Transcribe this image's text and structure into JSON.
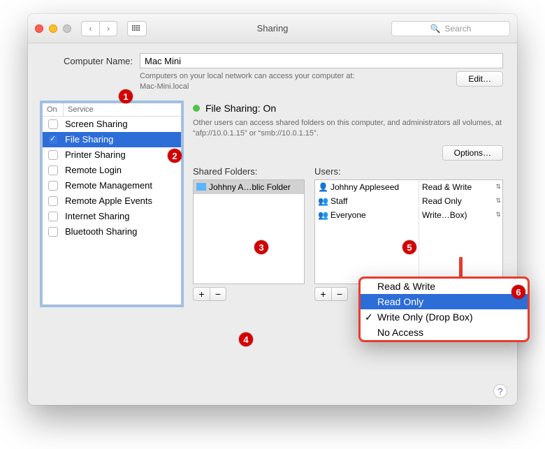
{
  "window": {
    "title": "Sharing"
  },
  "search": {
    "placeholder": "Search"
  },
  "computer": {
    "label": "Computer Name:",
    "value": "Mac Mini",
    "hint1": "Computers on your local network can access your computer at:",
    "hint2": "Mac-Mini.local",
    "edit": "Edit…"
  },
  "services": {
    "header_on": "On",
    "header_service": "Service",
    "items": [
      {
        "label": "Screen Sharing",
        "checked": false
      },
      {
        "label": "File Sharing",
        "checked": true,
        "selected": true
      },
      {
        "label": "Printer Sharing",
        "checked": false
      },
      {
        "label": "Remote Login",
        "checked": false
      },
      {
        "label": "Remote Management",
        "checked": false
      },
      {
        "label": "Remote Apple Events",
        "checked": false
      },
      {
        "label": "Internet Sharing",
        "checked": false
      },
      {
        "label": "Bluetooth Sharing",
        "checked": false
      }
    ]
  },
  "status": {
    "title": "File Sharing: On",
    "desc": "Other users can access shared folders on this computer, and administrators all volumes, at “afp://10.0.1.15” or “smb://10.0.1.15”.",
    "options": "Options…"
  },
  "shared": {
    "label": "Shared Folders:",
    "items": [
      "Johhny A…blic Folder"
    ]
  },
  "users": {
    "label": "Users:",
    "rows": [
      {
        "name": "Johhny Appleseed",
        "perm": "Read & Write",
        "icon": "person"
      },
      {
        "name": "Staff",
        "perm": "Read Only",
        "icon": "group2"
      },
      {
        "name": "Everyone",
        "perm": "Write…Box)",
        "icon": "group3"
      }
    ]
  },
  "dropdown": {
    "options": [
      "Read & Write",
      "Read Only",
      "Write Only (Drop Box)",
      "No Access"
    ],
    "selected_index": 1,
    "checked_index": 2
  },
  "buttons": {
    "plus": "+",
    "minus": "−"
  },
  "callouts": {
    "1": "1",
    "2": "2",
    "3": "3",
    "4": "4",
    "5": "5",
    "6": "6"
  },
  "help": "?"
}
